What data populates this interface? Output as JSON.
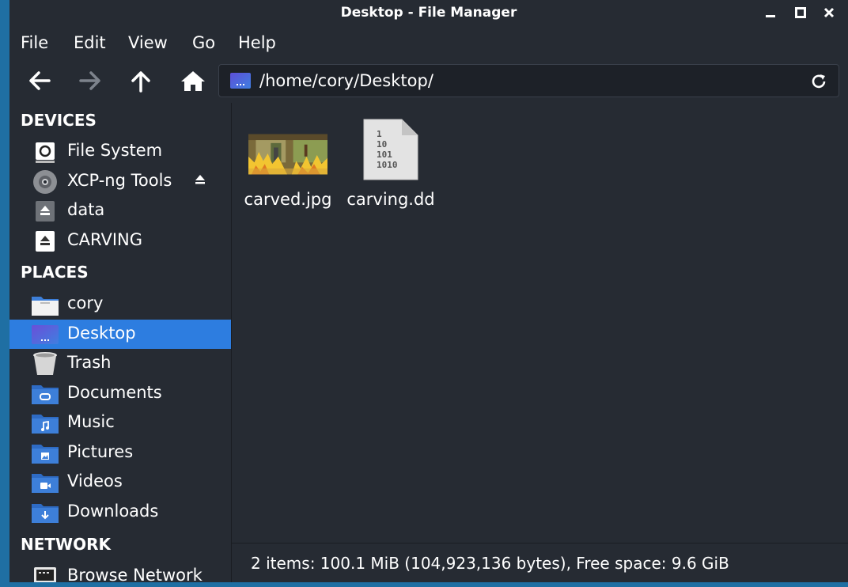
{
  "window": {
    "title": "Desktop - File Manager"
  },
  "menu": [
    "File",
    "Edit",
    "View",
    "Go",
    "Help"
  ],
  "toolbar": {
    "location_path": "/home/cory/Desktop/"
  },
  "sidebar": {
    "devices_heading": "DEVICES",
    "places_heading": "PLACES",
    "network_heading": "NETWORK",
    "devices": [
      {
        "label": "File System",
        "icon": "hard-drive-icon"
      },
      {
        "label": "XCP-ng Tools",
        "icon": "optical-disc-icon"
      },
      {
        "label": "data",
        "icon": "removable-drive-icon"
      },
      {
        "label": "CARVING",
        "icon": "removable-drive-icon"
      }
    ],
    "places": [
      {
        "label": "cory",
        "icon": "home-folder-icon"
      },
      {
        "label": "Desktop",
        "icon": "desktop-icon"
      },
      {
        "label": "Trash",
        "icon": "trash-icon"
      },
      {
        "label": "Documents",
        "icon": "documents-folder-icon"
      },
      {
        "label": "Music",
        "icon": "music-folder-icon"
      },
      {
        "label": "Pictures",
        "icon": "pictures-folder-icon"
      },
      {
        "label": "Videos",
        "icon": "videos-folder-icon"
      },
      {
        "label": "Downloads",
        "icon": "downloads-folder-icon"
      }
    ],
    "network": [
      {
        "label": "Browse Network",
        "icon": "network-icon"
      }
    ]
  },
  "files": [
    {
      "name": "carved.jpg",
      "icon": "image-thumbnail-icon"
    },
    {
      "name": "carving.dd",
      "icon": "binary-file-icon"
    }
  ],
  "binary_icon_text": [
    "1",
    "10",
    "101",
    "1010"
  ],
  "status": "2 items: 100.1 MiB (104,923,136 bytes), Free space: 9.6 GiB",
  "colors": {
    "background": "#262b33",
    "selection": "#2d7de0",
    "folder": "#3d7fd9",
    "text": "#ffffff"
  }
}
